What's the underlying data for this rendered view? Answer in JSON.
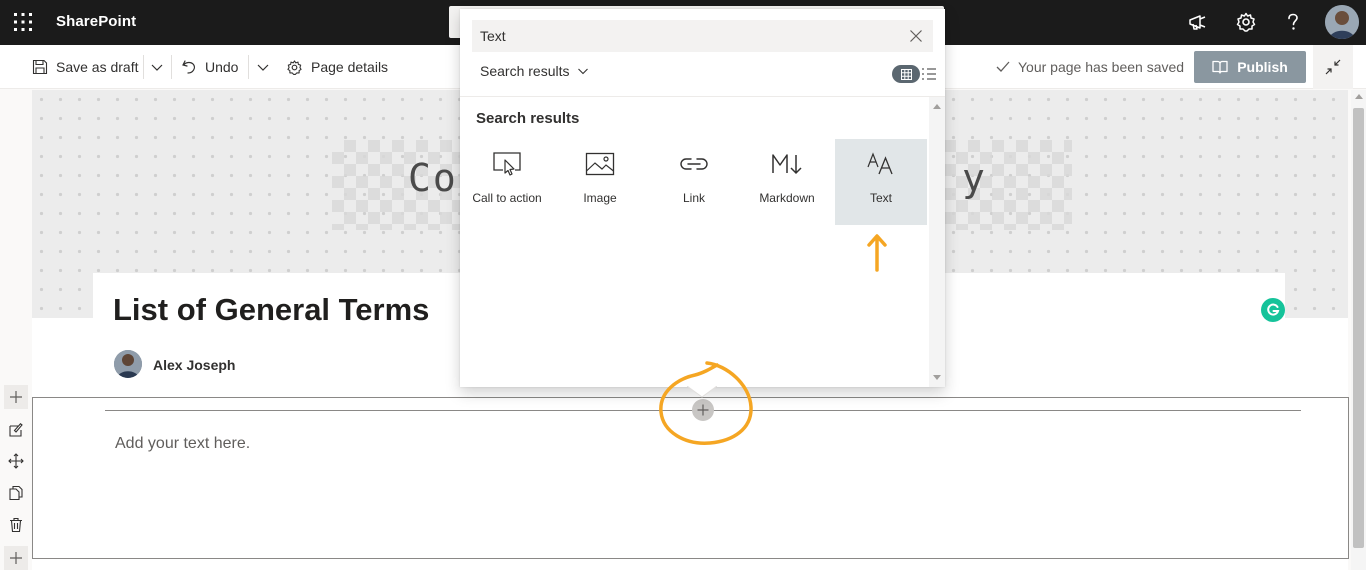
{
  "suite": {
    "app_name": "SharePoint"
  },
  "commands": {
    "save_draft": "Save as draft",
    "undo": "Undo",
    "page_details": "Page details",
    "saved_status": "Your page has been saved",
    "publish": "Publish"
  },
  "banner": {
    "text_left": "Cor",
    "text_right": "y"
  },
  "page": {
    "title": "List of General Terms",
    "author": "Alex Joseph",
    "text_placeholder": "Add your text here."
  },
  "toolbox": {
    "search_value": "Text",
    "filter_label": "Search results",
    "results_heading": "Search results",
    "items": [
      {
        "label": "Call to action",
        "icon": "call-to-action-icon"
      },
      {
        "label": "Image",
        "icon": "image-icon"
      },
      {
        "label": "Link",
        "icon": "link-icon"
      },
      {
        "label": "Markdown",
        "icon": "markdown-icon"
      },
      {
        "label": "Text",
        "icon": "text-icon",
        "selected": true
      }
    ]
  },
  "colors": {
    "suite_bar": "#1b1b1b",
    "publish_button": "#8a97a0",
    "annotation": "#f5a623",
    "grammarly": "#15c39a"
  }
}
